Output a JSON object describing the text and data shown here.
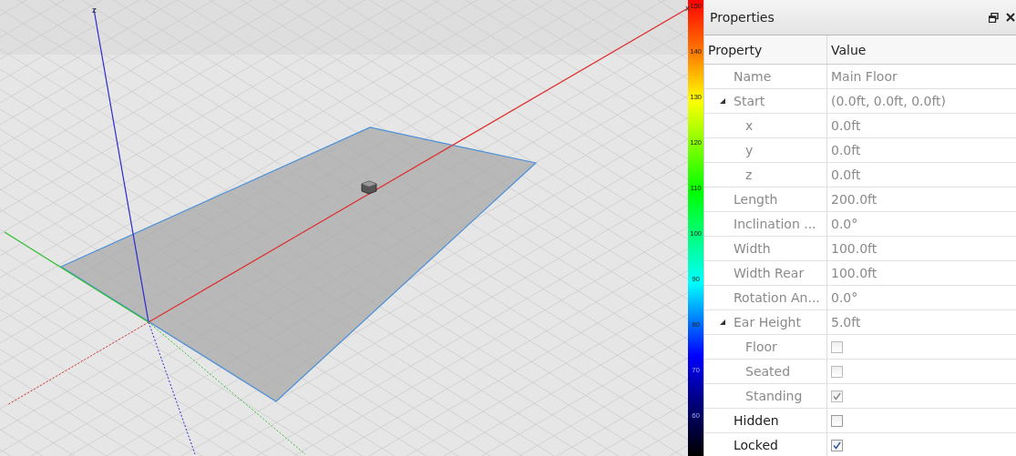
{
  "viewport": {
    "axis_labels": [
      {
        "kind": "z",
        "text": "z"
      },
      {
        "kind": "x",
        "text": "x"
      }
    ]
  },
  "color_scale": {
    "ticks": [
      "150",
      "140",
      "130",
      "120",
      "110",
      "100",
      "90",
      "80",
      "70",
      "60"
    ]
  },
  "properties": {
    "title": "Properties",
    "columns": [
      "Property",
      "Value"
    ],
    "rows": [
      {
        "name": "Name",
        "kind": "text",
        "value": "Main Floor",
        "disabled": true
      },
      {
        "name": "Start",
        "kind": "text",
        "value": "(0.0ft, 0.0ft, 0.0ft)",
        "disabled": true,
        "expanded": true,
        "children": [
          {
            "name": "x",
            "kind": "text",
            "value": "0.0ft",
            "disabled": true
          },
          {
            "name": "y",
            "kind": "text",
            "value": "0.0ft",
            "disabled": true
          },
          {
            "name": "z",
            "kind": "text",
            "value": "0.0ft",
            "disabled": true
          }
        ]
      },
      {
        "name": "Length",
        "kind": "text",
        "value": "200.0ft",
        "disabled": true
      },
      {
        "name": "Inclination ...",
        "kind": "text",
        "value": "0.0°",
        "disabled": true
      },
      {
        "name": "Width",
        "kind": "text",
        "value": "100.0ft",
        "disabled": true
      },
      {
        "name": "Width Rear",
        "kind": "text",
        "value": "100.0ft",
        "disabled": true
      },
      {
        "name": "Rotation An...",
        "kind": "text",
        "value": "0.0°",
        "disabled": true
      },
      {
        "name": "Ear Height",
        "kind": "text",
        "value": "5.0ft",
        "disabled": true,
        "expanded": true,
        "children": [
          {
            "name": "Floor",
            "kind": "checkbox",
            "checked": false,
            "disabled": true
          },
          {
            "name": "Seated",
            "kind": "checkbox",
            "checked": false,
            "disabled": true
          },
          {
            "name": "Standing",
            "kind": "checkbox",
            "checked": true,
            "disabled": true
          }
        ]
      },
      {
        "name": "Hidden",
        "kind": "checkbox",
        "checked": false,
        "disabled": false
      },
      {
        "name": "Locked",
        "kind": "checkbox",
        "checked": true,
        "disabled": false
      }
    ]
  }
}
